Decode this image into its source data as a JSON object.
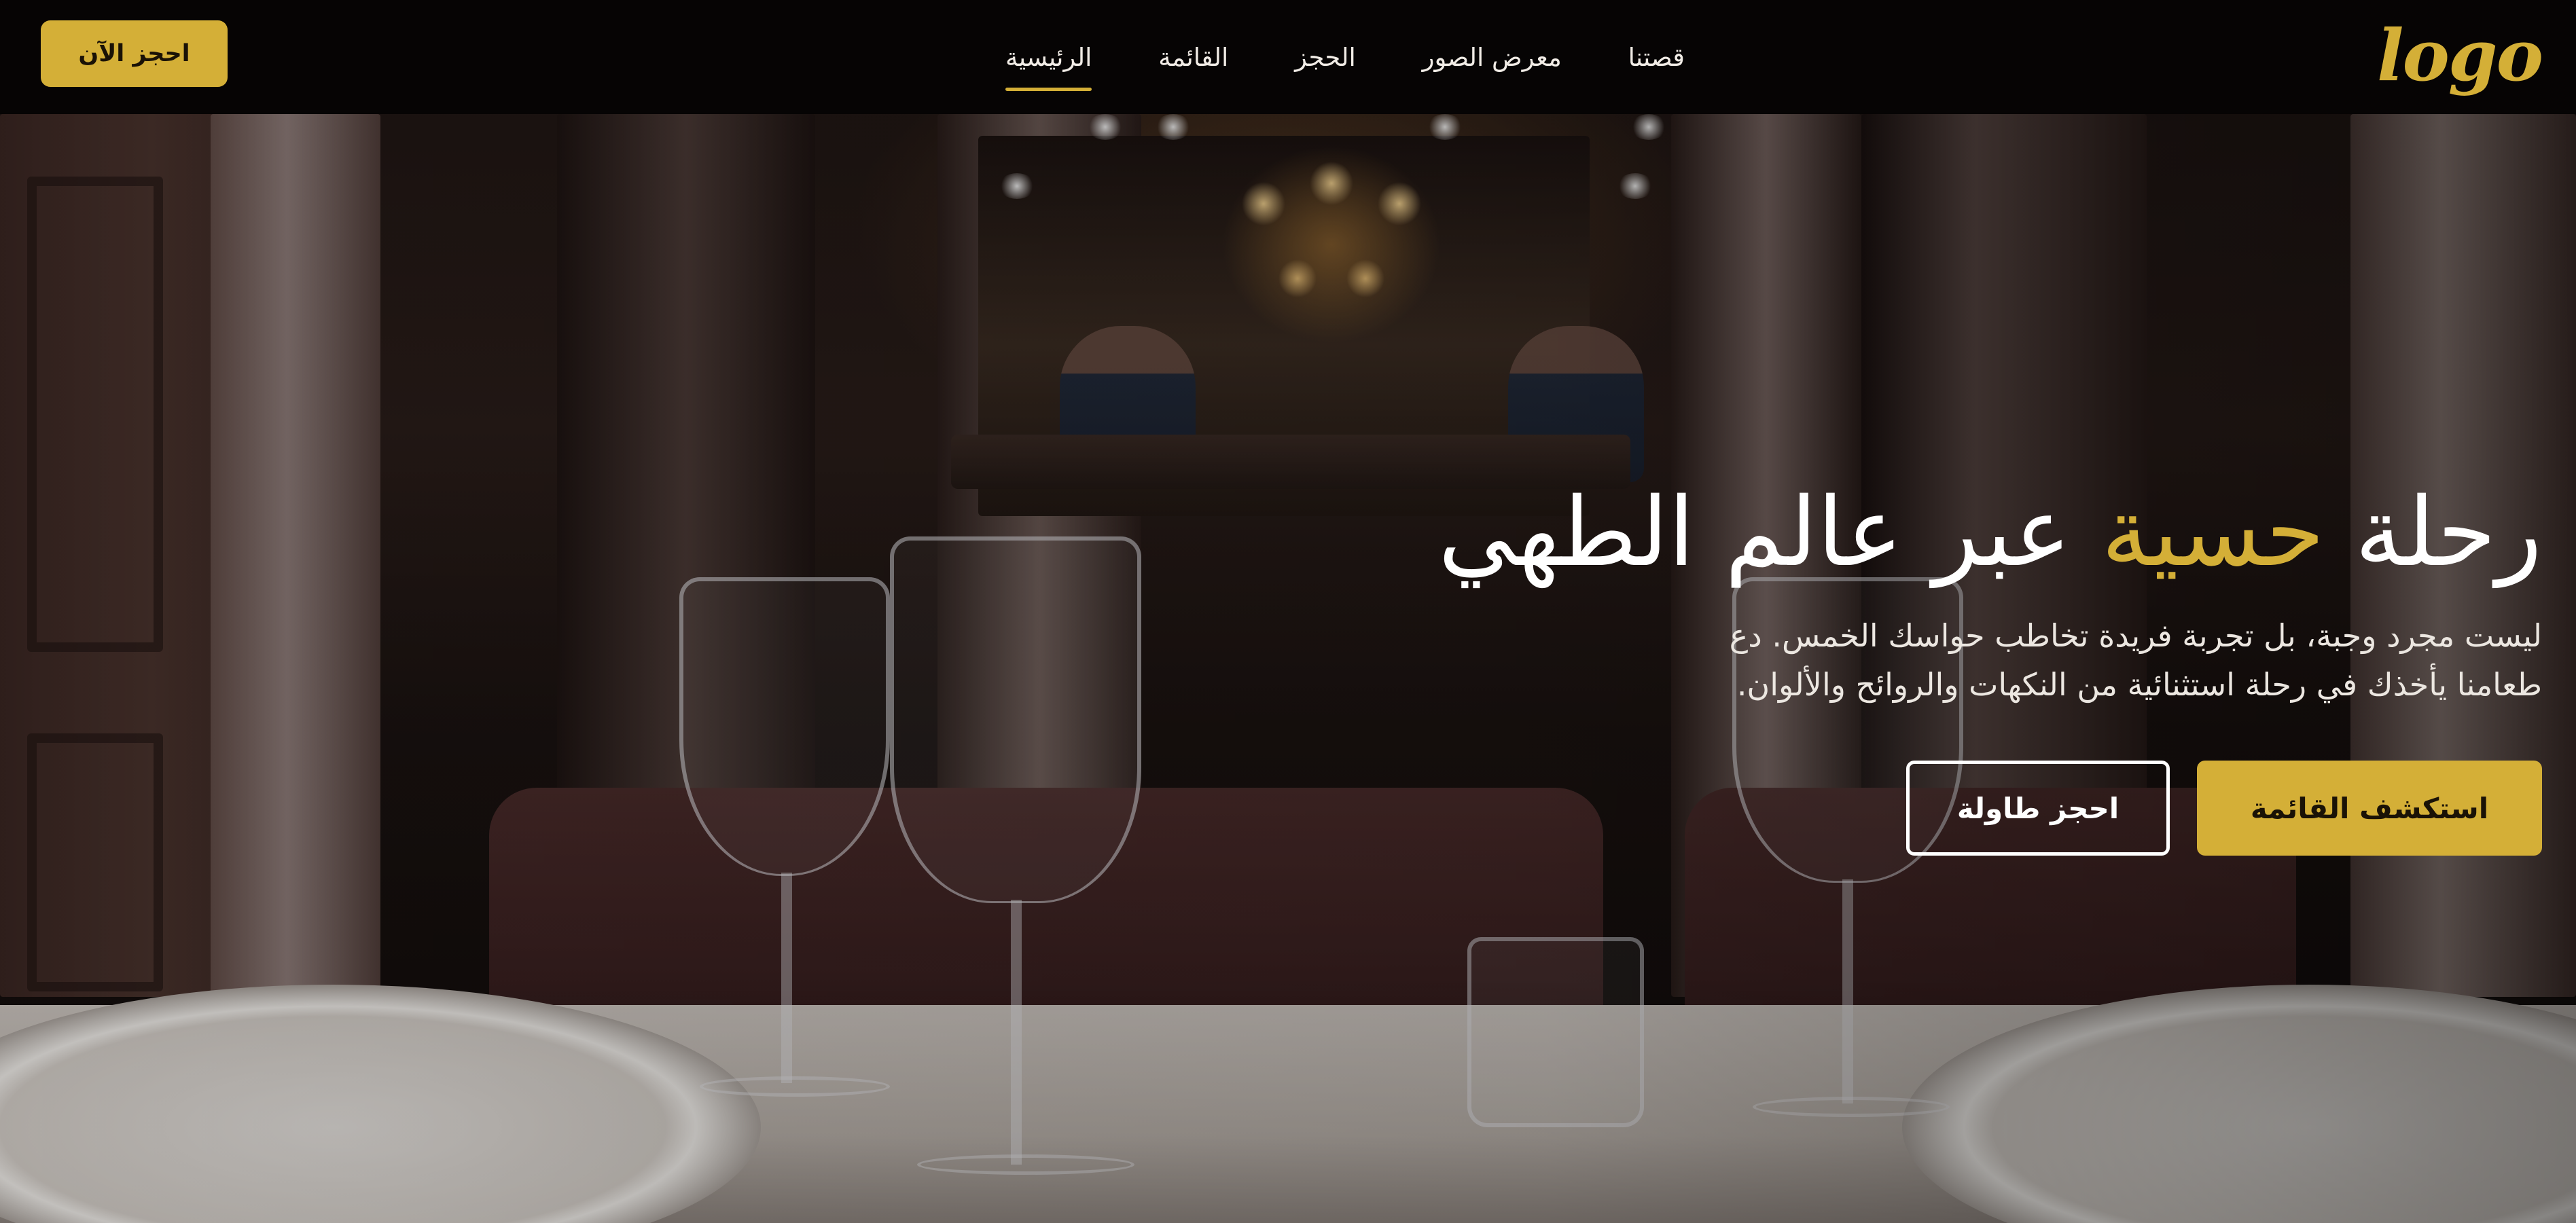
{
  "theme": {
    "accent": "#D4AF37",
    "nav_bg": "#060404",
    "text": "#FFFFFF"
  },
  "navbar": {
    "logo_text": "logo",
    "links": [
      {
        "label": "الرئيسية",
        "active": true
      },
      {
        "label": "القائمة",
        "active": false
      },
      {
        "label": "الحجز",
        "active": false
      },
      {
        "label": "معرض الصور",
        "active": false
      },
      {
        "label": "قصتنا",
        "active": false
      }
    ],
    "cta_label": "احجز الآن"
  },
  "hero": {
    "headline_part1": "رحلة ",
    "headline_highlight": "حسية",
    "headline_part2": " عبر عالم الطهي",
    "subtext": "ليست مجرد وجبة، بل تجربة فريدة تخاطب حواسك الخمس. دع طعامنا يأخذك في رحلة استثنائية من النكهات والروائح والألوان.",
    "primary_button": "استكشف القائمة",
    "secondary_button": "احجز طاولة"
  }
}
